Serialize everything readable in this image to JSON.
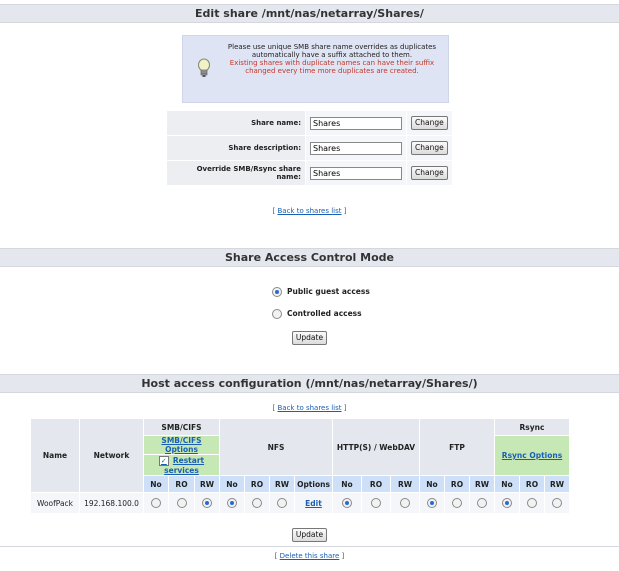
{
  "edit": {
    "title": "Edit share /mnt/nas/netarray/Shares/",
    "info_line1": "Please use unique SMB share name overrides as duplicates automatically have a suffix attached to them.",
    "info_line2": "Existing shares with duplicate names can have their suffix changed every time more duplicates are created.",
    "name_label": "Share name:",
    "name_value": "Shares",
    "desc_label": "Share description:",
    "desc_value": "Shares",
    "override_label": "Override SMB/Rsync share name:",
    "override_value": "Shares",
    "change_label": "Change",
    "back_link": "Back to shares list"
  },
  "access": {
    "title": "Share Access Control Mode",
    "public_label": "Public guest access",
    "controlled_label": "Controlled access",
    "selected": "public",
    "update_label": "Update"
  },
  "host": {
    "title": "Host access configuration (/mnt/nas/netarray/Shares/)",
    "back_link": "Back to shares list",
    "col_name": "Name",
    "col_network": "Network",
    "smb": "SMB/CIFS",
    "smb_options": "SMB/CIFS Options",
    "restart": "Restart services",
    "restart_checked": true,
    "nfs": "NFS",
    "http": "HTTP(S) / WebDAV",
    "ftp": "FTP",
    "rsync": "Rsync",
    "rsync_options": "Rsync Options",
    "perm_no": "No",
    "perm_ro": "RO",
    "perm_rw": "RW",
    "options": "Options",
    "rows": [
      {
        "name": "WoofPack",
        "network": "192.168.100.0",
        "smb": "RW",
        "nfs": "No",
        "nfs_edit": "Edit",
        "http": "No",
        "ftp": "No",
        "rsync": "No"
      }
    ],
    "update_label": "Update",
    "delete_link": "Delete this share"
  },
  "colors": {
    "accent": "#2a6ad8",
    "bar": "#e4e8ee",
    "green": "#c6e8b4",
    "warn": "#c0392b"
  },
  "icons": {
    "info": "lightbulb-icon"
  }
}
